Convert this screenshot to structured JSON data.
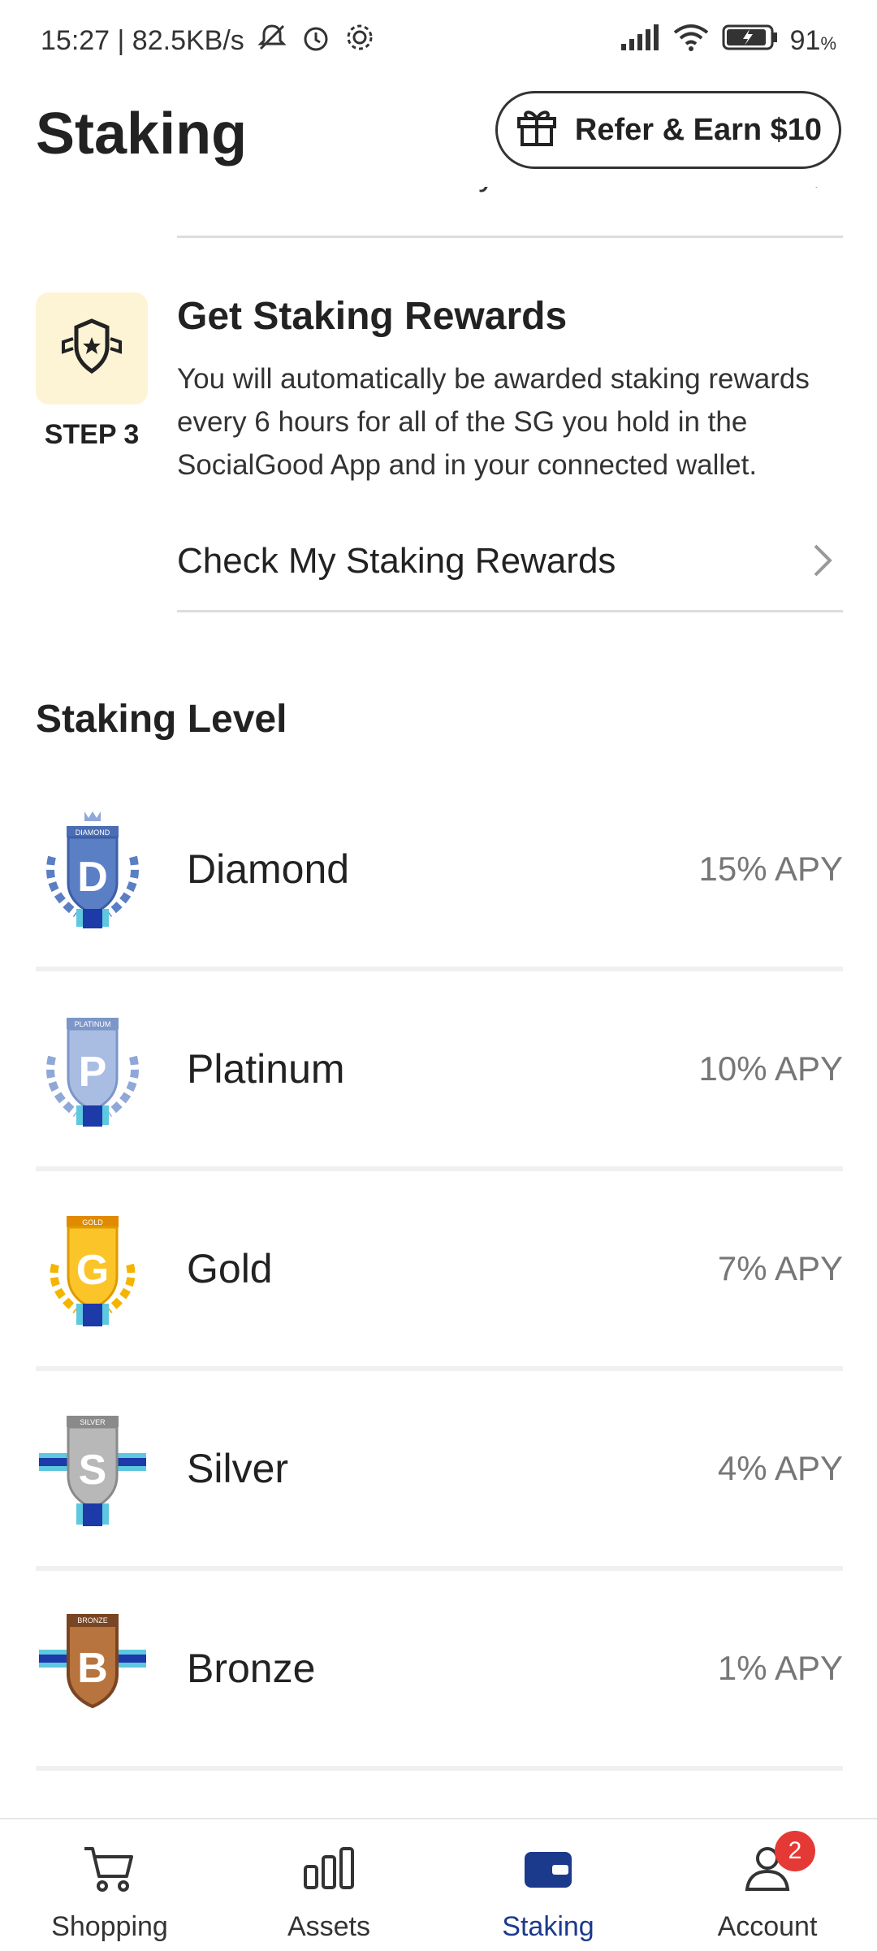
{
  "status_bar": {
    "time_speed": "15:27 | 82.5KB/s",
    "battery": "91",
    "battery_unit": "%"
  },
  "header": {
    "title": "Staking",
    "refer_button": "Refer & Earn $10"
  },
  "previous_row": {
    "label": "SG Purchase History"
  },
  "step": {
    "label": "STEP 3",
    "title": "Get Staking Rewards",
    "description": "You will automatically be awarded staking rewards every 6 hours for all of the SG you hold in the SocialGood App and in your connected wallet.",
    "link": "Check My Staking Rewards"
  },
  "staking_level": {
    "title": "Staking Level",
    "levels": [
      {
        "name": "Diamond",
        "apy": "15% APY",
        "badge_letter": "D",
        "badge_caption": "DIAMOND",
        "color": "#5b7fc4"
      },
      {
        "name": "Platinum",
        "apy": "10% APY",
        "badge_letter": "P",
        "badge_caption": "PLATINUM",
        "color": "#8fa8d8"
      },
      {
        "name": "Gold",
        "apy": "7% APY",
        "badge_letter": "G",
        "badge_caption": "GOLD",
        "color": "#f5b400"
      },
      {
        "name": "Silver",
        "apy": "4% APY",
        "badge_letter": "S",
        "badge_caption": "SILVER",
        "color": "#a6a6a6"
      },
      {
        "name": "Bronze",
        "apy": "1% APY",
        "badge_letter": "B",
        "badge_caption": "BRONZE",
        "color": "#a5663a"
      }
    ]
  },
  "bottom_nav": {
    "items": [
      {
        "label": "Shopping",
        "icon": "cart-icon"
      },
      {
        "label": "Assets",
        "icon": "bar-chart-icon"
      },
      {
        "label": "Staking",
        "icon": "wallet-icon",
        "active": true
      },
      {
        "label": "Account",
        "icon": "person-icon",
        "badge": "2"
      }
    ]
  },
  "colors": {
    "accent": "#1c3a8c",
    "step_bg": "#fdf4d6",
    "badge_red": "#e53935"
  }
}
